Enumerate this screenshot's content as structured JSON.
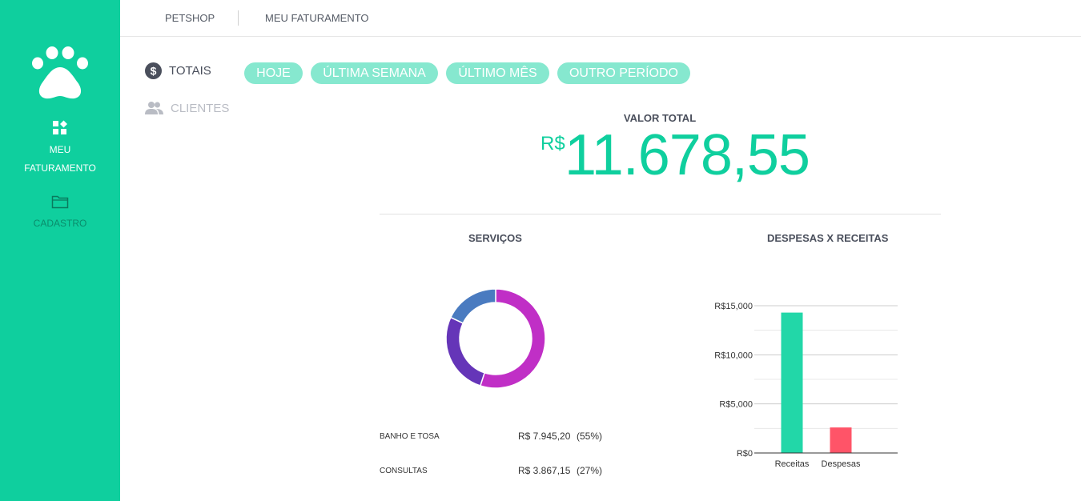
{
  "sidebar": {
    "items": [
      {
        "label_line1": "MEU",
        "label_line2": "FATURAMENTO",
        "icon": "dashboard-icon"
      },
      {
        "label": "CADASTRO",
        "icon": "folder-icon"
      }
    ]
  },
  "topbar": {
    "crumbs": [
      "PETSHOP",
      "MEU FATURAMENTO"
    ]
  },
  "nav": {
    "totais": "TOTAIS",
    "clientes": "CLIENTES"
  },
  "filters": [
    "HOJE",
    "ÚLTIMA SEMANA",
    "ÚLTIMO MÊS",
    "OUTRO PERÍODO"
  ],
  "total": {
    "label": "VALOR TOTAL",
    "currency": "R$",
    "value": "11.678,55"
  },
  "servicos": {
    "title": "SERVIÇOS",
    "rows": [
      {
        "name": "BANHO E TOSA",
        "value": "R$ 7.945,20",
        "pct": "(55%)"
      },
      {
        "name": "CONSULTAS",
        "value": "R$ 3.867,15",
        "pct": "(27%)"
      }
    ]
  },
  "despesas": {
    "title": "DESPESAS X RECEITAS"
  },
  "colors": {
    "accent": "#0fcf9e",
    "pill": "#86e8cf",
    "receitas": "#22d7a8",
    "despesas": "#ff5468",
    "donut_magenta": "#c02fc6",
    "donut_purple": "#6535b8",
    "donut_blue": "#4a7bc0"
  },
  "chart_data": [
    {
      "type": "pie",
      "title": "SERVIÇOS",
      "categories": [
        "BANHO E TOSA",
        "CONSULTAS",
        ""
      ],
      "values": [
        55,
        27,
        18
      ],
      "colors": [
        "#c02fc6",
        "#6535b8",
        "#4a7bc0"
      ]
    },
    {
      "type": "bar",
      "title": "DESPESAS X RECEITAS",
      "categories": [
        "Receitas",
        "Despesas"
      ],
      "values": [
        14300,
        2600
      ],
      "colors": [
        "#22d7a8",
        "#ff5468"
      ],
      "ylim": [
        0,
        15000
      ],
      "yticks": [
        "R$0",
        "R$5,000",
        "R$10,000",
        "R$15,000"
      ],
      "grid": true
    }
  ]
}
